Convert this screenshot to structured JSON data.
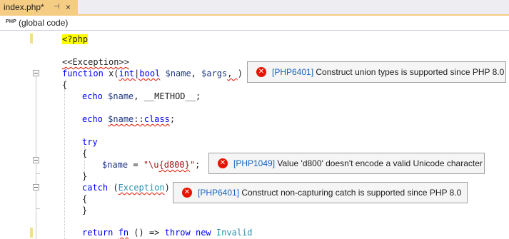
{
  "tab": {
    "title": "index.php*",
    "pin": "⊣",
    "close": "×"
  },
  "navbar": {
    "icon": "PHP",
    "scope": "(global code)"
  },
  "code": {
    "l1": "<?php",
    "l2": "<<Exception>>",
    "l3": {
      "kw": "function",
      "name": " x(",
      "t1": "int",
      "sep": "|",
      "t2": "bool",
      "rest1": " ",
      "v1": "$name",
      "comma": ", ",
      "v2": "$args",
      "tail1": ", ",
      "tail2": ")"
    },
    "l4": "{",
    "l5": {
      "kw": "echo",
      "sp": " ",
      "v": "$name",
      "rest": ", __METHOD__;"
    },
    "l6": {
      "kw": "echo",
      "sp": " ",
      "v": "$name",
      "rest": "::",
      "kw2": "class",
      "end": ";"
    },
    "l7": "try",
    "l8": "{",
    "l9": {
      "v": "$name",
      "eq": " = ",
      "s1": "\"\\u",
      "s2": "{d800}",
      "s3": "\"",
      "end": ";"
    },
    "l10": "}",
    "l11": {
      "kw": "catch",
      "p1": " (",
      "cls": "Exception",
      "p2": ")"
    },
    "l12": "{",
    "l13": "}",
    "l14": {
      "kw": "return",
      "sp": " ",
      "fn": "fn",
      "rest": " () => ",
      "kw2": "throw",
      "sp2": " ",
      "kw3": "new",
      "sp3": " ",
      "cls": "Invalid"
    }
  },
  "errors": [
    {
      "code": "[PHP6401]",
      "message": "Construct union types is supported since PHP 8.0"
    },
    {
      "code": "[PHP1049]",
      "message": "Value 'd800' doesn't encode a valid Unicode character"
    },
    {
      "code": "[PHP6401]",
      "message": "Construct non-capturing catch is supported since PHP 8.0"
    }
  ]
}
